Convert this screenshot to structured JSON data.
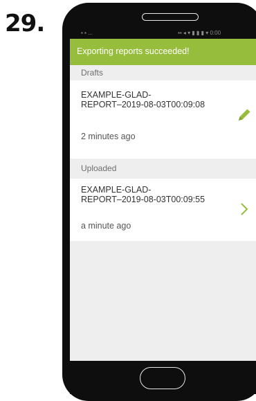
{
  "step": {
    "number": "29."
  },
  "status_bar": {
    "left_text": "▪ ▪ ...",
    "right_text": "▪▪ ◂ ▾ ▮ ▮ ▮ ▾ 0:00"
  },
  "toast": {
    "message": "Exporting reports succeeded!"
  },
  "sections": {
    "drafts": {
      "title": "Drafts",
      "items": [
        {
          "name_line1": "EXAMPLE-GLAD-",
          "name_line2": "REPORT–2019-08-03T00:09:08",
          "time": "2 minutes ago",
          "action_icon": "pencil-edit-icon"
        }
      ]
    },
    "uploaded": {
      "title": "Uploaded",
      "items": [
        {
          "name_line1": "EXAMPLE-GLAD-",
          "name_line2": "REPORT–2019-08-03T00:09:55",
          "time": "a minute ago",
          "action_icon": "chevron-right-icon"
        }
      ]
    }
  },
  "colors": {
    "accent": "#97bd3d",
    "screen_background": "#eeeeee",
    "row_background": "#ffffff",
    "phone_body": "#0e0e0e"
  }
}
